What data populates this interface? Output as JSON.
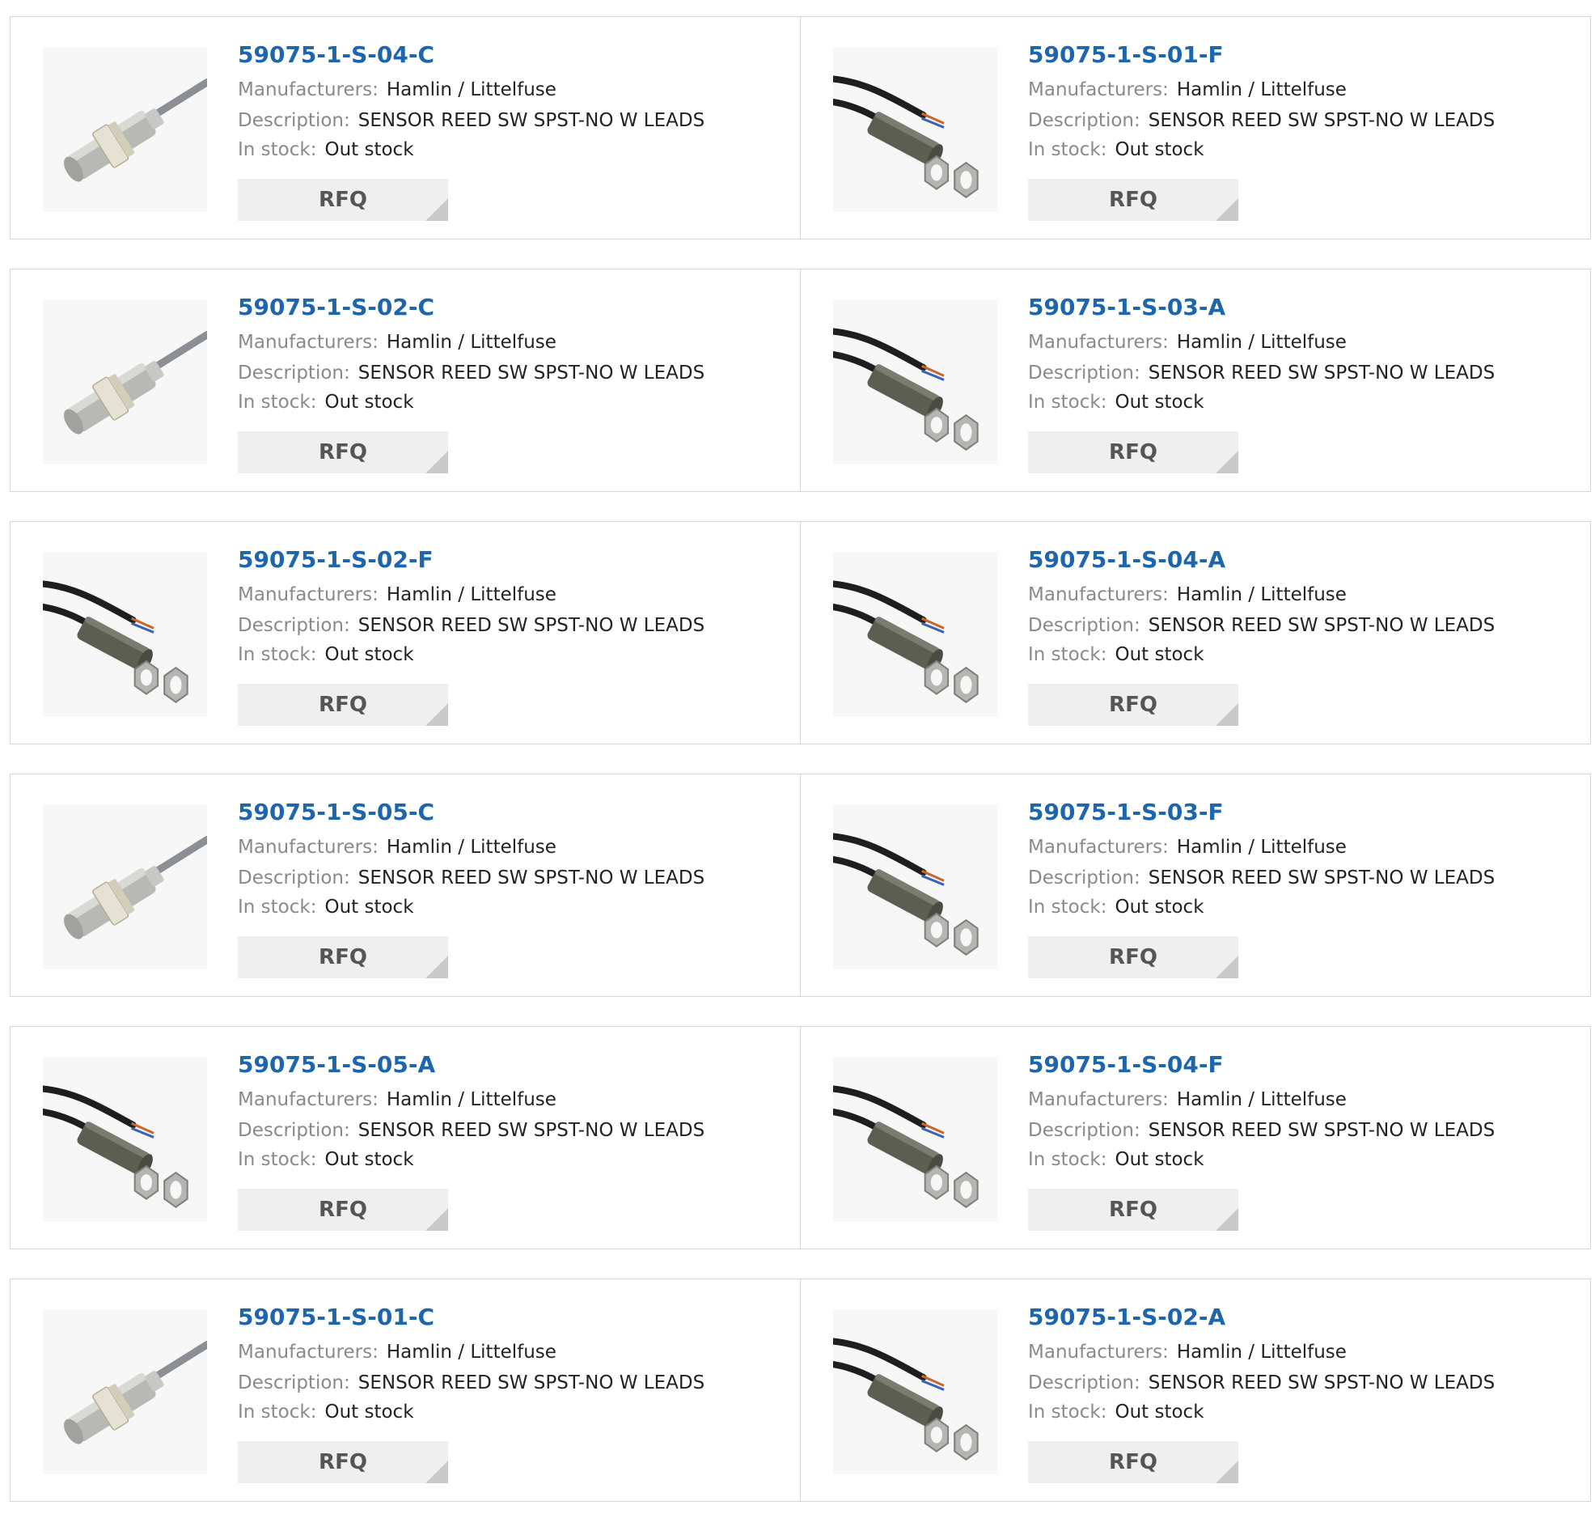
{
  "labels": {
    "manufacturers": "Manufacturers:",
    "description": "Description:",
    "in_stock": "In stock:",
    "rfq": "RFQ"
  },
  "colors": {
    "part_link": "#1d65ad",
    "label_gray": "#8a8a8a",
    "rfq_bg": "#efefef",
    "rfq_corner": "#c9c9c9",
    "border": "#d6d6d6"
  },
  "products": [
    {
      "part": "59075-1-S-04-C",
      "manufacturer": "Hamlin / Littelfuse",
      "description": "SENSOR REED SW SPST-NO W LEADS",
      "stock": "Out stock",
      "image": "threaded-sensor-gray-cable"
    },
    {
      "part": "59075-1-S-01-F",
      "manufacturer": "Hamlin / Littelfuse",
      "description": "SENSOR REED SW SPST-NO W LEADS",
      "stock": "Out stock",
      "image": "cylinder-sensor-black-cable-nuts"
    },
    {
      "part": "59075-1-S-02-C",
      "manufacturer": "Hamlin / Littelfuse",
      "description": "SENSOR REED SW SPST-NO W LEADS",
      "stock": "Out stock",
      "image": "threaded-sensor-gray-cable"
    },
    {
      "part": "59075-1-S-03-A",
      "manufacturer": "Hamlin / Littelfuse",
      "description": "SENSOR REED SW SPST-NO W LEADS",
      "stock": "Out stock",
      "image": "cylinder-sensor-black-cable-nuts"
    },
    {
      "part": "59075-1-S-02-F",
      "manufacturer": "Hamlin / Littelfuse",
      "description": "SENSOR REED SW SPST-NO W LEADS",
      "stock": "Out stock",
      "image": "cylinder-sensor-black-cable-nuts"
    },
    {
      "part": "59075-1-S-04-A",
      "manufacturer": "Hamlin / Littelfuse",
      "description": "SENSOR REED SW SPST-NO W LEADS",
      "stock": "Out stock",
      "image": "cylinder-sensor-black-cable-nuts"
    },
    {
      "part": "59075-1-S-05-C",
      "manufacturer": "Hamlin / Littelfuse",
      "description": "SENSOR REED SW SPST-NO W LEADS",
      "stock": "Out stock",
      "image": "threaded-sensor-gray-cable"
    },
    {
      "part": "59075-1-S-03-F",
      "manufacturer": "Hamlin / Littelfuse",
      "description": "SENSOR REED SW SPST-NO W LEADS",
      "stock": "Out stock",
      "image": "cylinder-sensor-black-cable-nuts"
    },
    {
      "part": "59075-1-S-05-A",
      "manufacturer": "Hamlin / Littelfuse",
      "description": "SENSOR REED SW SPST-NO W LEADS",
      "stock": "Out stock",
      "image": "cylinder-sensor-black-cable-nuts"
    },
    {
      "part": "59075-1-S-04-F",
      "manufacturer": "Hamlin / Littelfuse",
      "description": "SENSOR REED SW SPST-NO W LEADS",
      "stock": "Out stock",
      "image": "cylinder-sensor-black-cable-nuts"
    },
    {
      "part": "59075-1-S-01-C",
      "manufacturer": "Hamlin / Littelfuse",
      "description": "SENSOR REED SW SPST-NO W LEADS",
      "stock": "Out stock",
      "image": "threaded-sensor-gray-cable"
    },
    {
      "part": "59075-1-S-02-A",
      "manufacturer": "Hamlin / Littelfuse",
      "description": "SENSOR REED SW SPST-NO W LEADS",
      "stock": "Out stock",
      "image": "cylinder-sensor-black-cable-nuts"
    }
  ]
}
